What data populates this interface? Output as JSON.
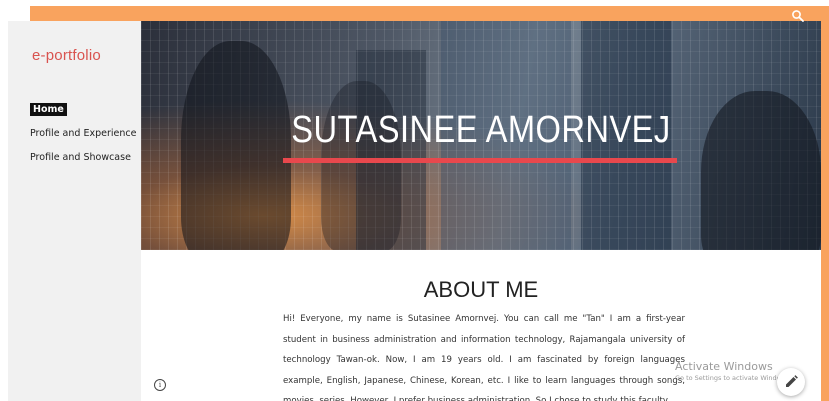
{
  "site": {
    "brand": "e-portfolio"
  },
  "nav": {
    "items": [
      {
        "label": "Home",
        "active": true
      },
      {
        "label": "Profile and Experience",
        "active": false
      },
      {
        "label": "Profile and Showcase",
        "active": false
      }
    ]
  },
  "hero": {
    "title": "SUTASINEE AMORNVEJ",
    "underline_color": "#e8484d"
  },
  "about": {
    "heading": "ABOUT ME",
    "body": "Hi! Everyone, my name is Sutasinee Amornvej. You can call me \"Tan\" I am a first-year student in business administration and information technology, Rajamangala university of technology Tawan-ok. Now, I am 19 years old. I am fascinated by foreign languages example, English, Japanese, Chinese, Korean, etc. I like to learn languages through songs, movies, series. However, I prefer business administration. So I chose to study this faculty."
  },
  "watermark": {
    "line1": "Activate Windows",
    "line2": "Go to Settings to activate Windows."
  },
  "icons": {
    "search": "search-icon",
    "info": "info-icon",
    "edit": "pencil-icon"
  },
  "colors": {
    "brand": "#d9534f",
    "frame": "#f9a35e",
    "sidebar": "#f1f1f1"
  }
}
